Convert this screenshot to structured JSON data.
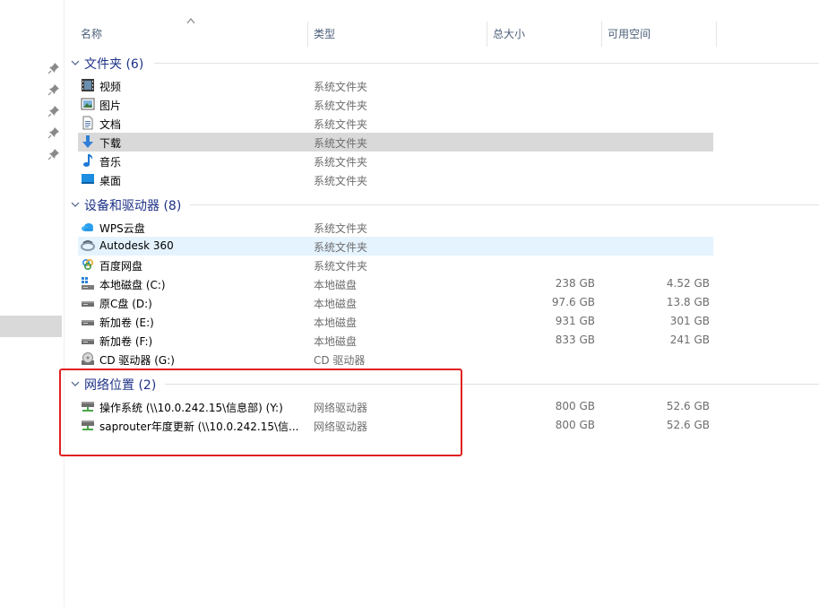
{
  "columns": {
    "name": "名称",
    "type": "类型",
    "total": "总大小",
    "free": "可用空间"
  },
  "groups": [
    {
      "title": "文件夹 (6)",
      "items": [
        {
          "name": "视频",
          "type": "系统文件夹",
          "icon": "video-folder-icon"
        },
        {
          "name": "图片",
          "type": "系统文件夹",
          "icon": "pictures-folder-icon"
        },
        {
          "name": "文档",
          "type": "系统文件夹",
          "icon": "documents-folder-icon"
        },
        {
          "name": "下载",
          "type": "系统文件夹",
          "icon": "download-arrow-icon"
        },
        {
          "name": "音乐",
          "type": "系统文件夹",
          "icon": "music-note-icon"
        },
        {
          "name": "桌面",
          "type": "系统文件夹",
          "icon": "desktop-icon"
        }
      ]
    },
    {
      "title": "设备和驱动器 (8)",
      "items": [
        {
          "name": "WPS云盘",
          "type": "系统文件夹",
          "icon": "cloud-icon"
        },
        {
          "name": "Autodesk 360",
          "type": "系统文件夹",
          "icon": "autodesk-icon"
        },
        {
          "name": "百度网盘",
          "type": "系统文件夹",
          "icon": "baidu-cloud-icon"
        },
        {
          "name": "本地磁盘 (C:)",
          "type": "本地磁盘",
          "total": "238 GB",
          "free": "4.52 GB",
          "icon": "windows-drive-icon"
        },
        {
          "name": "原C盘 (D:)",
          "type": "本地磁盘",
          "total": "97.6 GB",
          "free": "13.8 GB",
          "icon": "drive-icon"
        },
        {
          "name": "新加卷 (E:)",
          "type": "本地磁盘",
          "total": "931 GB",
          "free": "301 GB",
          "icon": "drive-icon"
        },
        {
          "name": "新加卷 (F:)",
          "type": "本地磁盘",
          "total": "833 GB",
          "free": "241 GB",
          "icon": "drive-icon"
        },
        {
          "name": "CD 驱动器 (G:)",
          "type": "CD 驱动器",
          "icon": "cd-drive-icon"
        }
      ]
    },
    {
      "title": "网络位置 (2)",
      "items": [
        {
          "name": "操作系统 (\\\\10.0.242.15\\信息部) (Y:)",
          "type": "网络驱动器",
          "total": "800 GB",
          "free": "52.6 GB",
          "icon": "network-drive-icon"
        },
        {
          "name": "saprouter年度更新 (\\\\10.0.242.15\\信...",
          "type": "网络驱动器",
          "total": "800 GB",
          "free": "52.6 GB",
          "icon": "network-drive-icon"
        }
      ]
    }
  ],
  "colors": {
    "group_title": "#1e3287",
    "selected_row": "#d9d9d9",
    "hover_row": "#e5f3ff",
    "annotation": "#e02020"
  }
}
